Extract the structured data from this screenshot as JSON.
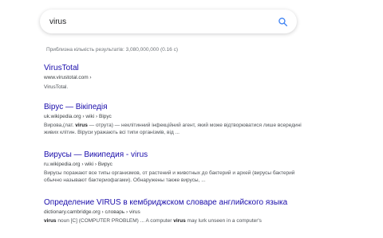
{
  "search": {
    "query": "virus"
  },
  "stats": "Приблизна кількість результатів: 3,080,000,000 (0.16 с)",
  "results": [
    {
      "title": "VirusTotal",
      "url": "www.virustotal.com ›",
      "snippet": "VirusTotal."
    },
    {
      "title": "Вірус — Вікіпедія",
      "url": "uk.wikipedia.org › wiki › Вірус",
      "snippet_parts": [
        "Вирова,(лат. ",
        "virus",
        " — отрута) — неклітинний інфекційний агент, який може відтворюватися лише всередині живих клітин. Віруси уражають всі типи організмів, від ..."
      ]
    },
    {
      "title": "Вирусы — Википедия - virus",
      "url": "ru.wikipedia.org › wiki › Вирус",
      "snippet": "Вирусы поражают все типы организмов, от растений и животных до бактерий и архей (вирусы бактерий обычно называют бактериофагами). Обнаружены также вирусы, ..."
    },
    {
      "title": "Определение VIRUS в кембриджском словаре английского языка",
      "url": "dictionary.cambridge.org › словарь › virus",
      "snippet_parts": [
        "virus",
        " noun [C] (COMPUTER PROBLEM) ... A computer ",
        "virus",
        " may lurk unseen in a computer's"
      ]
    }
  ],
  "icons": {
    "search": "search-icon"
  },
  "colors": {
    "link": "#1a0dab",
    "search_icon": "#4285f4"
  }
}
